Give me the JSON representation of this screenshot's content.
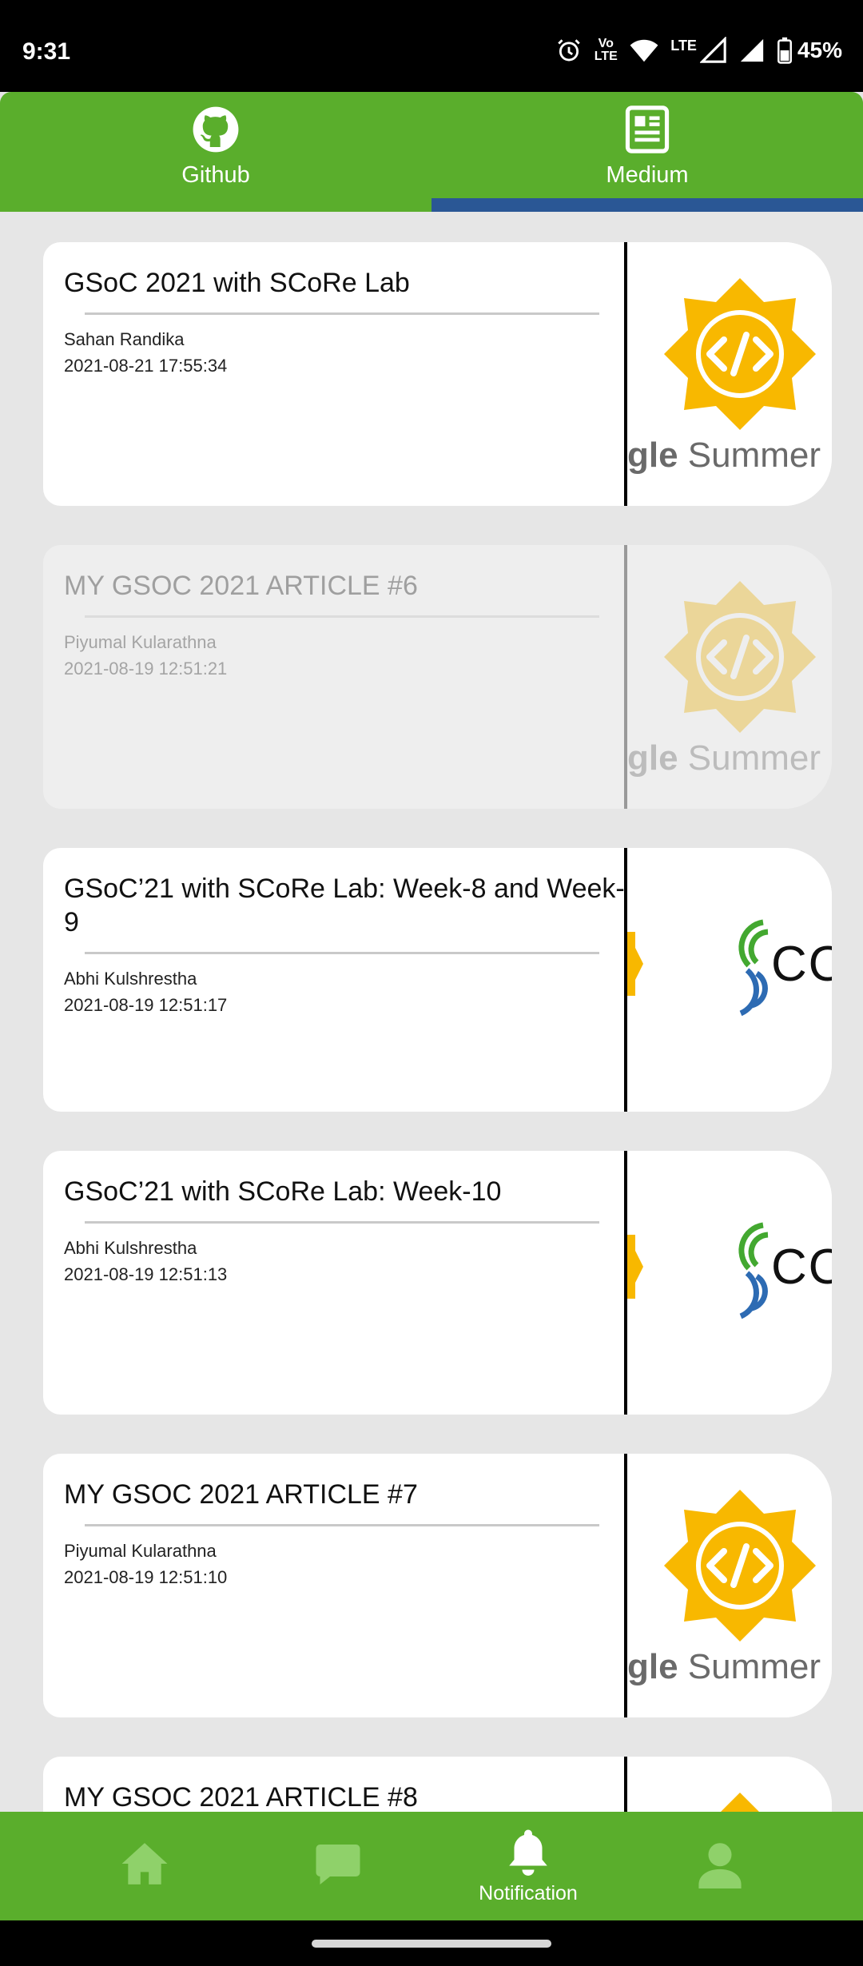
{
  "status_bar": {
    "time": "9:31",
    "volte_label": "Vo LTE",
    "lte_label": "LTE",
    "battery": "45%"
  },
  "tabs": [
    {
      "label": "Github",
      "icon": "github-icon",
      "selected": false
    },
    {
      "label": "Medium",
      "icon": "article-icon",
      "selected": true
    }
  ],
  "articles": [
    {
      "title": "GSoC 2021 with SCoRe Lab",
      "author": "Sahan Randika",
      "date": "2021-08-21 17:55:34",
      "thumb": "gsoc"
    },
    {
      "title": "MY GSOC 2021 ARTICLE #6",
      "author": "Piyumal Kularathna",
      "date": "2021-08-19 12:51:21",
      "thumb": "gsoc"
    },
    {
      "title": "GSoC’21 with SCoRe Lab: Week-8 and Week-9",
      "author": "Abhi Kulshrestha",
      "date": "2021-08-19 12:51:17",
      "thumb": "score"
    },
    {
      "title": "GSoC’21 with SCoRe Lab: Week-10",
      "author": "Abhi Kulshrestha",
      "date": "2021-08-19 12:51:13",
      "thumb": "score"
    },
    {
      "title": "MY GSOC 2021 ARTICLE #7",
      "author": "Piyumal Kularathna",
      "date": "2021-08-19 12:51:10",
      "thumb": "gsoc"
    },
    {
      "title": "MY GSOC 2021 ARTICLE #8",
      "author": "",
      "date": "",
      "thumb": "gsoc"
    }
  ],
  "thumb_text": {
    "gsoc_prefix": "gle",
    "gsoc_suffix": " Summer of",
    "score_mark": "CO"
  },
  "bottom_nav": [
    {
      "label": "",
      "icon": "home-icon",
      "active": false
    },
    {
      "label": "",
      "icon": "chat-icon",
      "active": false
    },
    {
      "label": "Notification",
      "icon": "bell-icon",
      "active": true
    },
    {
      "label": "",
      "icon": "profile-icon",
      "active": false
    }
  ],
  "colors": {
    "brand_green": "#5aae2c",
    "tab_indicator": "#2a5795",
    "gsoc_yellow": "#f8b800",
    "inactive_nav_icon": "#8fd16a"
  }
}
